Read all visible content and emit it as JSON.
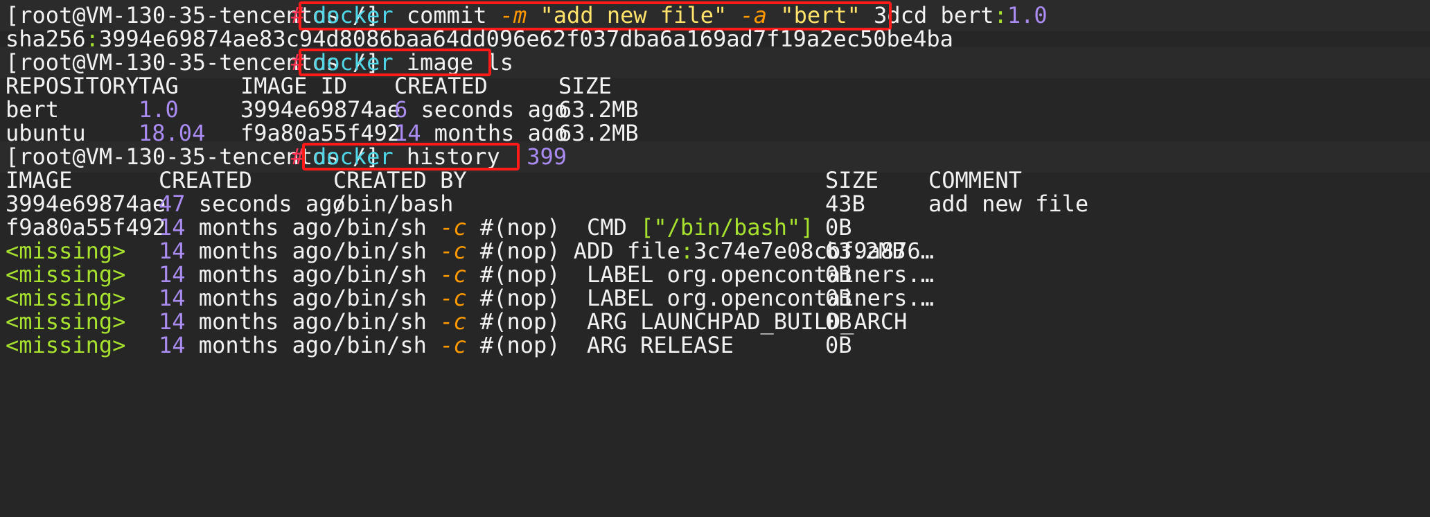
{
  "prompt": "[root@VM-130-35-tencentos /]",
  "prompt_symbol": "#",
  "cmd1": {
    "docker": "docker",
    "commit": " commit ",
    "m_flag": "-m",
    "msg": "\"add new file\"",
    "a_flag": "-a",
    "author": "\"bert\"",
    "id": " 3dcd bert",
    "colon": ":",
    "ver": "1.0"
  },
  "sha_line": {
    "prefix": "sha256",
    "colon": ":",
    "hash": "3994e69874ae83c94d8086baa64dd096e62f037dba6a169ad7f19a2ec50be4ba"
  },
  "cmd2": {
    "docker": "docker",
    "rest": " image ls"
  },
  "images": {
    "headers": [
      "REPOSITORY",
      "TAG",
      "IMAGE ID",
      "CREATED",
      "SIZE"
    ],
    "rows": [
      {
        "repo": "bert",
        "tag": "1.0",
        "id": "3994e69874ae",
        "num": "6",
        "created": " seconds ago",
        "size": "63.2MB"
      },
      {
        "repo": "ubuntu",
        "tag": "18.04",
        "id": "f9a80a55f492",
        "num": "14",
        "created": " months ago",
        "size": "63.2MB"
      }
    ]
  },
  "cmd3": {
    "docker": "docker",
    "rest": " history  ",
    "arg": "399"
  },
  "history": {
    "headers": [
      "IMAGE",
      "CREATED",
      "CREATED BY",
      "SIZE",
      "COMMENT"
    ],
    "rows": [
      {
        "image": "3994e69874ae",
        "num": "47",
        "created": " seconds ago",
        "by": "/bin/bash",
        "size": "43B",
        "comment": "add new file"
      },
      {
        "image": "f9a80a55f492",
        "num": "14",
        "created": " months ago",
        "by_pre": "/bin/sh ",
        "flag": "-c",
        "by_mid": " #(nop)  CMD ",
        "by_str": "[\"/bin/bash\"]",
        "size": "0B",
        "comment": ""
      },
      {
        "image": "<missing>",
        "num": "14",
        "created": " months ago",
        "by_pre": "/bin/sh ",
        "flag": "-c",
        "by_mid": " #(nop) ADD file",
        "by_colon": ":",
        "by_tail": "3c74e7e08cbf9a876…",
        "size": "63.2MB",
        "comment": ""
      },
      {
        "image": "<missing>",
        "num": "14",
        "created": " months ago",
        "by_pre": "/bin/sh ",
        "flag": "-c",
        "by_mid": " #(nop)  LABEL org.opencontainers.…",
        "size": "0B",
        "comment": ""
      },
      {
        "image": "<missing>",
        "num": "14",
        "created": " months ago",
        "by_pre": "/bin/sh ",
        "flag": "-c",
        "by_mid": " #(nop)  LABEL org.opencontainers.…",
        "size": "0B",
        "comment": ""
      },
      {
        "image": "<missing>",
        "num": "14",
        "created": " months ago",
        "by_pre": "/bin/sh ",
        "flag": "-c",
        "by_mid": " #(nop)  ARG LAUNCHPAD_BUILD_ARCH",
        "size": "0B",
        "comment": ""
      },
      {
        "image": "<missing>",
        "num": "14",
        "created": " months ago",
        "by_pre": "/bin/sh ",
        "flag": "-c",
        "by_mid": " #(nop)  ARG RELEASE",
        "size": "0B",
        "comment": ""
      }
    ]
  },
  "colors": {
    "background": "#262626",
    "command": "#4fd7e8",
    "flag": "#ff9900",
    "string": "#ffe36b",
    "number": "#a98bf2",
    "prompt_hash": "#ff3355",
    "highlight_box": "#ff1a1a"
  }
}
